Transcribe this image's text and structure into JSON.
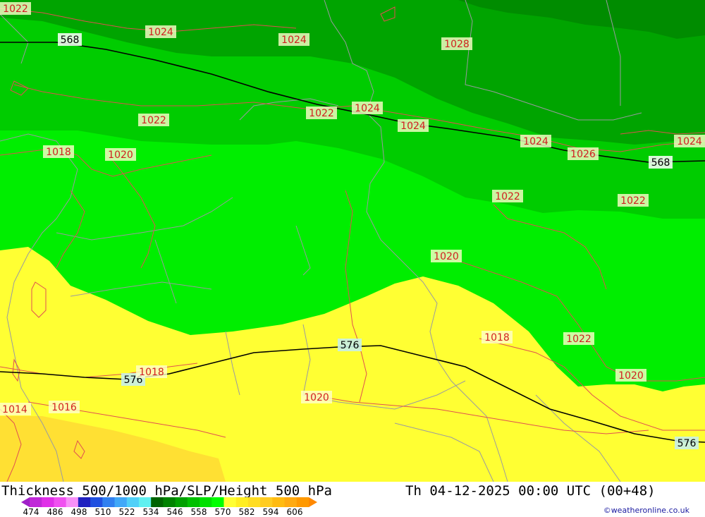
{
  "map": {
    "thickness_labels": [
      "568",
      "568",
      "576",
      "576",
      "576"
    ],
    "pressure_labels": [
      "1022",
      "1024",
      "1024",
      "1028",
      "1022",
      "1024",
      "1024",
      "1022",
      "1018",
      "1020",
      "1024",
      "1026",
      "1024",
      "1022",
      "1022",
      "1020",
      "1018",
      "1022",
      "1018",
      "1020",
      "1020",
      "1014",
      "1016"
    ]
  },
  "footer": {
    "title": "Thickness 500/1000 hPa/SLP/Height 500 hPa",
    "valid_time": "Th 04-12-2025 00:00 UTC (00+48)",
    "credit": "©weatheronline.co.uk",
    "colorbar": {
      "colors": [
        "#a020c8",
        "#c028d8",
        "#e030e8",
        "#f050f0",
        "#f890f8",
        "#2020c0",
        "#2050e0",
        "#3080f0",
        "#40a8f8",
        "#50d0f8",
        "#60f0f0",
        "#006400",
        "#008200",
        "#00a000",
        "#00c000",
        "#00e000",
        "#00ff00",
        "#ffff33",
        "#ffee22",
        "#ffdd22",
        "#ffcc22",
        "#ffbb11",
        "#ffaa11",
        "#ff9900",
        "#ff8800"
      ],
      "labels": [
        "474",
        "486",
        "498",
        "510",
        "522",
        "534",
        "546",
        "558",
        "570",
        "582",
        "594",
        "606"
      ]
    }
  },
  "legend_colors": {
    "thickness_568_band": "#00a000",
    "thickness_dark": "#008c00",
    "thickness_light": "#00ee00",
    "thickness_576_band": "#ffff33",
    "thickness_warm": "#ffe033",
    "isobar": "#e05050",
    "border": "#9a9aa0"
  }
}
